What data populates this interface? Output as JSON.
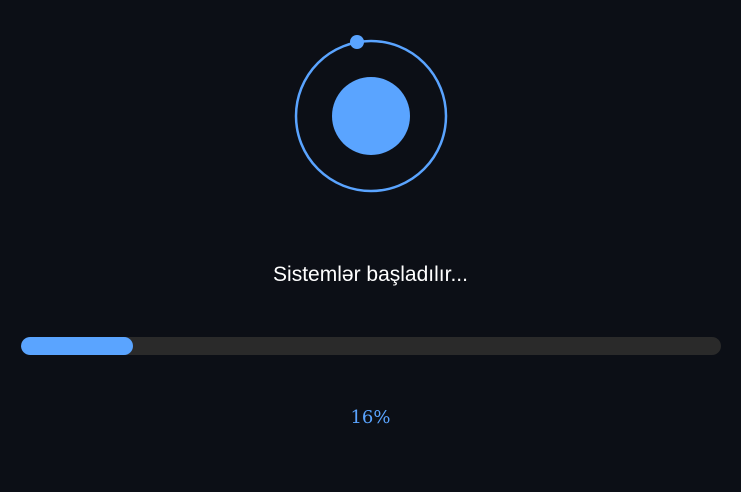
{
  "loader": {
    "icon": "orbit-loader-icon",
    "accent_color": "#5aa4ff"
  },
  "status": {
    "text": "Sistemlər başladılır..."
  },
  "progress": {
    "percent": 16,
    "label": "16%",
    "fill_color": "#5aa4ff",
    "track_color": "#2a2a2a"
  },
  "theme": {
    "background": "#0c0f16",
    "text_color": "#ffffff"
  }
}
